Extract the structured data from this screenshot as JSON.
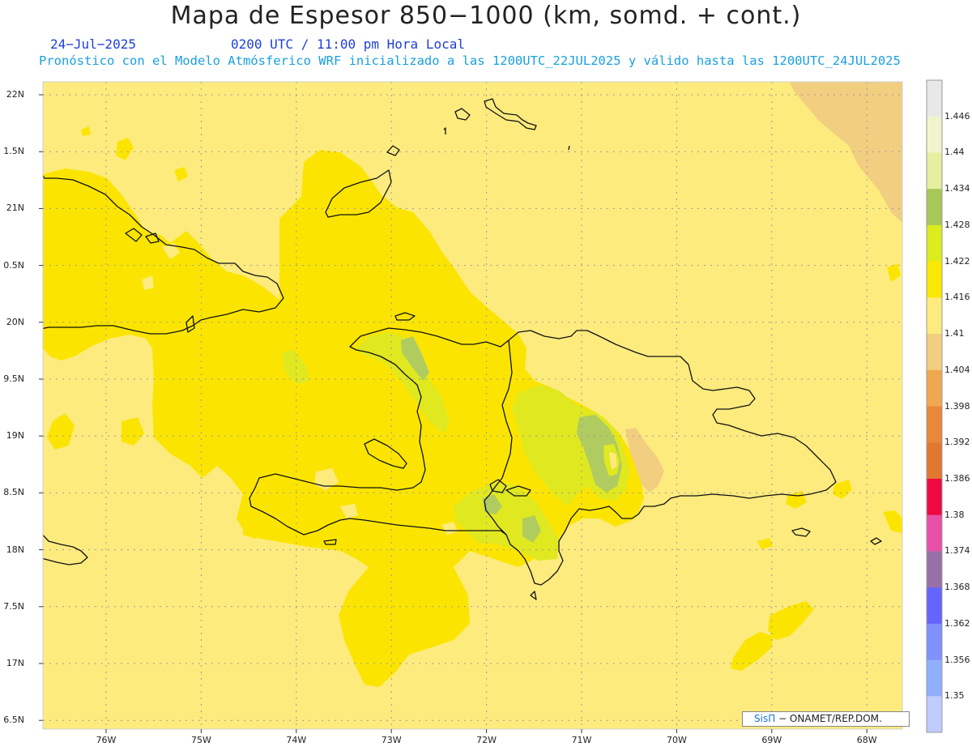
{
  "header": {
    "title": "Mapa de Espesor 850−1000 (km, somd. + cont.)",
    "date": "24−Jul−2025",
    "time": "0200 UTC / 11:00 pm Hora Local",
    "subtitle": "Pronóstico con el Modelo Atmósferico WRF inicializado a las 1200UTC_22JUL2025 y válido hasta las  1200UTC_24JUL2025"
  },
  "map": {
    "lat_labels": [
      "22N",
      "1.5N",
      "21N",
      "0.5N",
      "20N",
      "9.5N",
      "19N",
      "8.5N",
      "18N",
      "7.5N",
      "17N",
      "6.5N"
    ],
    "lon_labels": [
      "76W",
      "75W",
      "74W",
      "73W",
      "72W",
      "71W",
      "70W",
      "69W",
      "68W"
    ],
    "fill_colors": {
      "background": "#fdeb7e",
      "main": "#fbe500",
      "light_green": "#e0e820",
      "green": "#b0cc60",
      "orange": "#f2ce80"
    }
  },
  "colorbar": {
    "levels": [
      "1.446",
      "1.44",
      "1.434",
      "1.428",
      "1.422",
      "1.416",
      "1.41",
      "1.404",
      "1.398",
      "1.392",
      "1.386",
      "1.38",
      "1.374",
      "1.368",
      "1.362",
      "1.356",
      "1.35"
    ],
    "colors": [
      "#e8e8e8",
      "#f0f4cc",
      "#e4f0a0",
      "#a8c858",
      "#dcec1c",
      "#fbe800",
      "#fdeb7e",
      "#f2ce80",
      "#f0a850",
      "#e88838",
      "#e07830",
      "#f00840",
      "#e850a8",
      "#9870a8",
      "#6464ff",
      "#8090ff",
      "#90b0ff",
      "#c0ccff"
    ]
  },
  "credit": {
    "brand": "SisΠ",
    "text": "− ONAMET/REP.DOM."
  }
}
